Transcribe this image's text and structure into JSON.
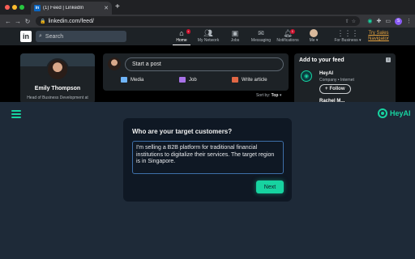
{
  "browser": {
    "tab_title": "(1) Feed | LinkedIn",
    "url": "linkedin.com/feed/",
    "profile_initial": "S"
  },
  "linkedin": {
    "logo": "in",
    "search_placeholder": "Search",
    "nav": [
      {
        "label": "Home",
        "icon": "home-icon",
        "badge": ""
      },
      {
        "label": "My Network",
        "icon": "network-icon",
        "badge": ""
      },
      {
        "label": "Jobs",
        "icon": "jobs-icon",
        "badge": ""
      },
      {
        "label": "Messaging",
        "icon": "messaging-icon",
        "badge": ""
      },
      {
        "label": "Notifications",
        "icon": "bell-icon",
        "badge": "1"
      },
      {
        "label": "Me",
        "icon": "avatar",
        "badge": ""
      },
      {
        "label": "For Business",
        "icon": "grid-icon",
        "badge": ""
      }
    ],
    "premium_label_1": "Try Sales",
    "premium_label_2": "Navigator",
    "profile": {
      "name": "Emily Thompson",
      "headline": "Head of Business Development at"
    },
    "post": {
      "start_post": "Start a post",
      "media": "Media",
      "job": "Job",
      "write_article": "Write article"
    },
    "sort_label": "Sort by:",
    "sort_value": "Top",
    "feed_suggestions": {
      "title": "Add to your feed",
      "item_name": "HeyAI",
      "item_sub": "Company • Internet",
      "follow_label": "Follow",
      "next_item": "Rachel M..."
    }
  },
  "heyai": {
    "brand": "HeyAI",
    "question": "Who are your target customers?",
    "answer": "I'm selling a B2B platform for traditional financial institutions to digitalize their services. The target region is in Singapore.",
    "next_label": "Next",
    "accent": "#17d3a0"
  }
}
